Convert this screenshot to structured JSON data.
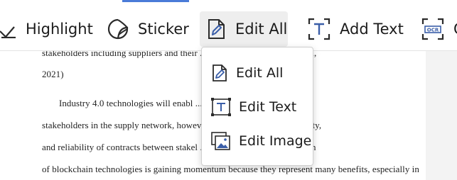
{
  "toolbar": {
    "tools": [
      {
        "label": "Highlight",
        "icon": "highlight-icon"
      },
      {
        "label": "Sticker",
        "icon": "sticker-icon"
      },
      {
        "label": "Edit All",
        "icon": "edit-all-icon"
      },
      {
        "label": "Add Text",
        "icon": "add-text-icon"
      },
      {
        "label": "C",
        "icon": "ocr-icon",
        "icon_text": "OCR"
      }
    ]
  },
  "edit_menu": {
    "items": [
      {
        "label": "Edit All",
        "icon": "edit-all-icon"
      },
      {
        "label": "Edit Text",
        "icon": "edit-text-icon"
      },
      {
        "label": "Edit Image",
        "icon": "edit-image-icon"
      }
    ]
  },
  "document": {
    "lines": [
      "stakeholders including suppliers and their ... ty activities. (Belhzidia et al,",
      "2021)",
      "Industry 4.0 technologies will enabl ... formation between multiple",
      "stakeholders in the supply network, howev ... garding security, traceability,",
      "and reliability of contracts between stakel ... upply chain. The application",
      "of blockchain technologies is gaining momentum because they represent many benefits, especially in"
    ]
  },
  "colors": {
    "accent": "#4a7bd8",
    "icon": "#3a5ea8",
    "text": "#1b1b1b"
  }
}
